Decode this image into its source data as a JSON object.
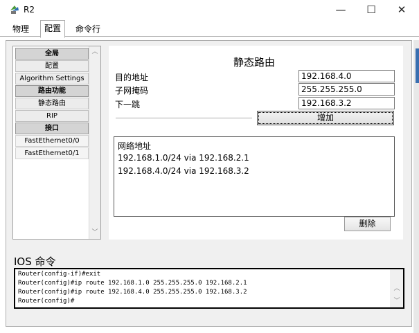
{
  "window": {
    "title": "R2",
    "minimize": "—",
    "maximize": "☐",
    "close": "✕"
  },
  "tabs": [
    {
      "label": "物理"
    },
    {
      "label": "配置"
    },
    {
      "label": "命令行"
    }
  ],
  "sidebar": {
    "items": [
      {
        "label": "全局",
        "kind": "header"
      },
      {
        "label": "配置",
        "kind": "item"
      },
      {
        "label": "Algorithm Settings",
        "kind": "item"
      },
      {
        "label": "路由功能",
        "kind": "header"
      },
      {
        "label": "静态路由",
        "kind": "item"
      },
      {
        "label": "RIP",
        "kind": "item"
      },
      {
        "label": "接口",
        "kind": "header"
      },
      {
        "label": "FastEthernet0/0",
        "kind": "normal"
      },
      {
        "label": "FastEthernet0/1",
        "kind": "normal"
      }
    ]
  },
  "static_route": {
    "title": "静态路由",
    "dest_label": "目的地址",
    "dest_value": "192.168.4.0",
    "mask_label": "子网掩码",
    "mask_value": "255.255.255.0",
    "nexthop_label": "下一跳",
    "nexthop_value": "192.168.3.2",
    "add_label": "增加",
    "list_header": "网络地址",
    "routes": [
      "192.168.1.0/24 via 192.168.2.1",
      "192.168.4.0/24 via 192.168.3.2"
    ],
    "delete_label": "删除"
  },
  "ios": {
    "label": "IOS 命令",
    "lines": [
      "Router(config-if)#exit",
      "Router(config)#ip route 192.168.1.0 255.255.255.0 192.168.2.1",
      "Router(config)#ip route 192.168.4.0 255.255.255.0 192.168.3.2",
      "Router(config)#"
    ]
  },
  "icons": {
    "app": "router-icon",
    "scroll_up": "chevron-up-icon",
    "scroll_down": "chevron-down-icon"
  }
}
